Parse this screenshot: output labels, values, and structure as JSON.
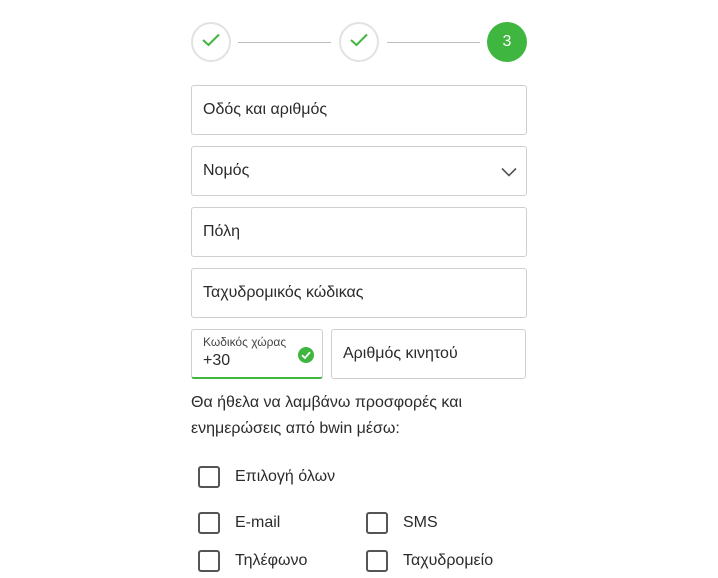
{
  "stepper": {
    "steps": [
      {
        "state": "done",
        "icon": "check-icon"
      },
      {
        "state": "done",
        "icon": "check-icon"
      },
      {
        "state": "active",
        "label": "3"
      }
    ],
    "accent_color": "#3fb63f"
  },
  "form": {
    "street_placeholder": "Οδός και αριθμός",
    "region_placeholder": "Νομός",
    "city_placeholder": "Πόλη",
    "postal_placeholder": "Ταχυδρομικός κώδικας",
    "country_code_label": "Κωδικός χώρας",
    "country_code_value": "+30",
    "mobile_placeholder": "Αριθμός κινητού"
  },
  "preferences": {
    "text": "Θα ήθελα να λαμβάνω προσφορές και ενημερώσεις από bwin μέσω:",
    "select_all": "Επιλογή όλων",
    "options": [
      "E-mail",
      "SMS",
      "Τηλέφωνο",
      "Ταχυδρομείο"
    ]
  }
}
